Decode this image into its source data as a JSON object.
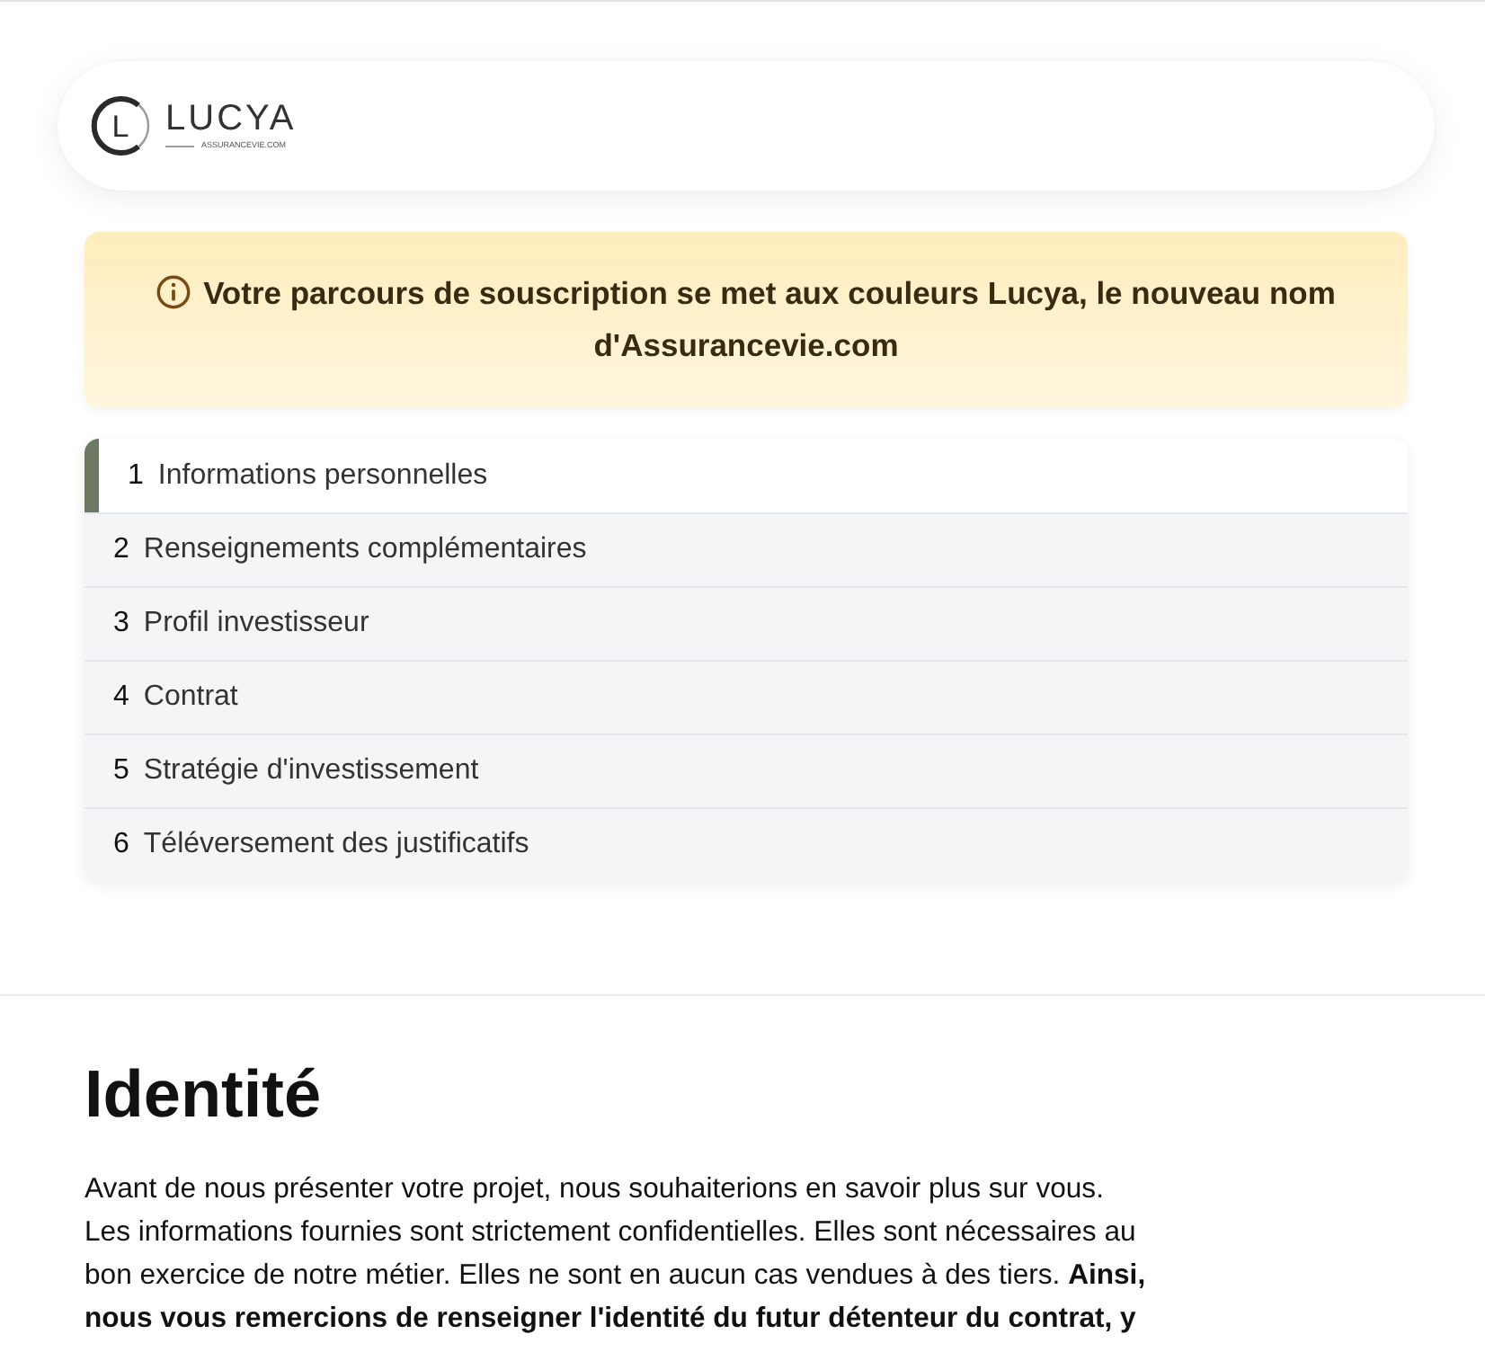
{
  "header": {
    "logo": {
      "monogram": "L",
      "wordmark": "LUCYA",
      "tagline": "ASSURANCEVIE.COM"
    }
  },
  "notice": {
    "text": "Votre parcours de souscription se met aux couleurs Lucya, le nouveau nom d'Assurancevie.com"
  },
  "steps": [
    {
      "number": "1",
      "label": "Informations personnelles",
      "selected": true
    },
    {
      "number": "2",
      "label": "Renseignements complémentaires",
      "selected": false
    },
    {
      "number": "3",
      "label": "Profil investisseur",
      "selected": false
    },
    {
      "number": "4",
      "label": "Contrat",
      "selected": false
    },
    {
      "number": "5",
      "label": "Stratégie d'investissement",
      "selected": false
    },
    {
      "number": "6",
      "label": "Téléversement des justificatifs",
      "selected": false
    }
  ],
  "section": {
    "title": "Identité",
    "intro": "Avant de nous présenter votre projet, nous souhaiterions en savoir plus sur vous. Les informations fournies sont strictement confidentielles. Elles sont nécessaires au bon exercice de notre métier. Elles ne sont en aucun cas vendues à des tiers. **Ainsi, nous vous remercions de renseigner l'identité du futur détenteur du contrat, y**"
  }
}
